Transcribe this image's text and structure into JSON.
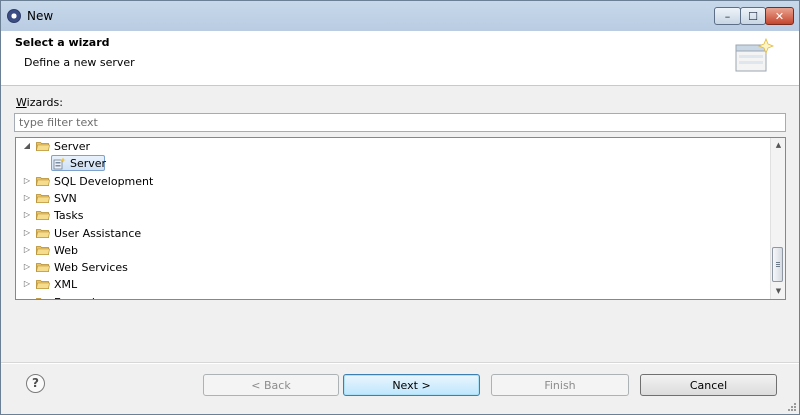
{
  "window": {
    "title": "New"
  },
  "titlebar_buttons": {
    "minimize": "–",
    "maximize": "☐",
    "close": "✕"
  },
  "header": {
    "title": "Select a wizard",
    "description": "Define a new server"
  },
  "wizards": {
    "label_accel": "W",
    "label_rest": "izards:",
    "filter_placeholder": "type filter text",
    "filter_value": ""
  },
  "tree": {
    "rows": [
      {
        "label": "Server",
        "expanded": true,
        "kind": "folder"
      },
      {
        "label": "Server",
        "kind": "item",
        "selected": true
      },
      {
        "label": "SQL Development",
        "expanded": false,
        "kind": "folder"
      },
      {
        "label": "SVN",
        "expanded": false,
        "kind": "folder"
      },
      {
        "label": "Tasks",
        "expanded": false,
        "kind": "folder"
      },
      {
        "label": "User Assistance",
        "expanded": false,
        "kind": "folder"
      },
      {
        "label": "Web",
        "expanded": false,
        "kind": "folder"
      },
      {
        "label": "Web Services",
        "expanded": false,
        "kind": "folder"
      },
      {
        "label": "XML",
        "expanded": false,
        "kind": "folder"
      },
      {
        "label": "Examples",
        "expanded": false,
        "kind": "folder"
      }
    ]
  },
  "buttons": {
    "help": "?",
    "back": "< Back",
    "next": "Next >",
    "finish": "Finish",
    "cancel": "Cancel"
  },
  "colors": {
    "title_bar": "#b9cce2",
    "selection": "#cfe1f5",
    "folder": "#e8c56a",
    "default_button_border": "#3c7fb1"
  },
  "icons": {
    "app": "eclipse-icon",
    "banner": "new-wizard-banner-icon",
    "folder": "folder-icon",
    "server": "server-wizard-icon",
    "help": "help-icon"
  }
}
